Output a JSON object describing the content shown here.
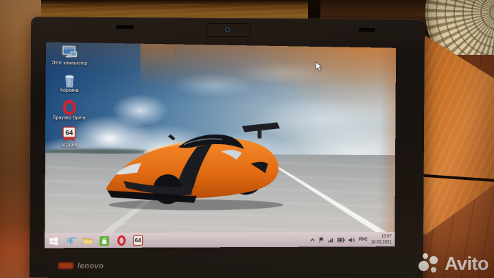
{
  "scene": {
    "watermark_text": "Avito",
    "laptop_brand_logo": "lenovo",
    "description": "Photo of a Lenovo ThinkPad laptop standing on a wooden table, screen showing a Windows 8.1 desktop"
  },
  "desktop": {
    "wallpaper_description": "Orange Koenigsegg supercar with a black racing stripe driving on an airport runway under a blue sky with large white clouds",
    "icons": [
      {
        "id": "this-pc",
        "label": "Этот компьютер"
      },
      {
        "id": "recycle-bin",
        "label": "Корзина"
      },
      {
        "id": "opera-browser",
        "label": "Браузер Opera"
      },
      {
        "id": "aida64",
        "label": "AIDA64",
        "icon_glyph": "64"
      }
    ]
  },
  "taskbar": {
    "buttons": [
      {
        "id": "start"
      },
      {
        "id": "internet-explorer",
        "glyph": "e"
      },
      {
        "id": "file-explorer"
      },
      {
        "id": "windows-store"
      },
      {
        "id": "opera"
      },
      {
        "id": "aida64",
        "glyph": "64",
        "active": true
      }
    ],
    "tray": {
      "icons": [
        "hidden-icons-chevron",
        "action-center-flag",
        "network",
        "battery",
        "volume"
      ],
      "language_indicator": "РУС",
      "time": "15:07",
      "date": "16.02.2021"
    }
  },
  "colors": {
    "car_orange": "#e8741e",
    "sky_blue": "#2b5a8c",
    "taskbar_tint": "#d6c4c8",
    "wood_table": "#c97428",
    "opera_red": "#d6202c",
    "store_green": "#5eb33c",
    "ie_blue": "#2aa9e0"
  }
}
